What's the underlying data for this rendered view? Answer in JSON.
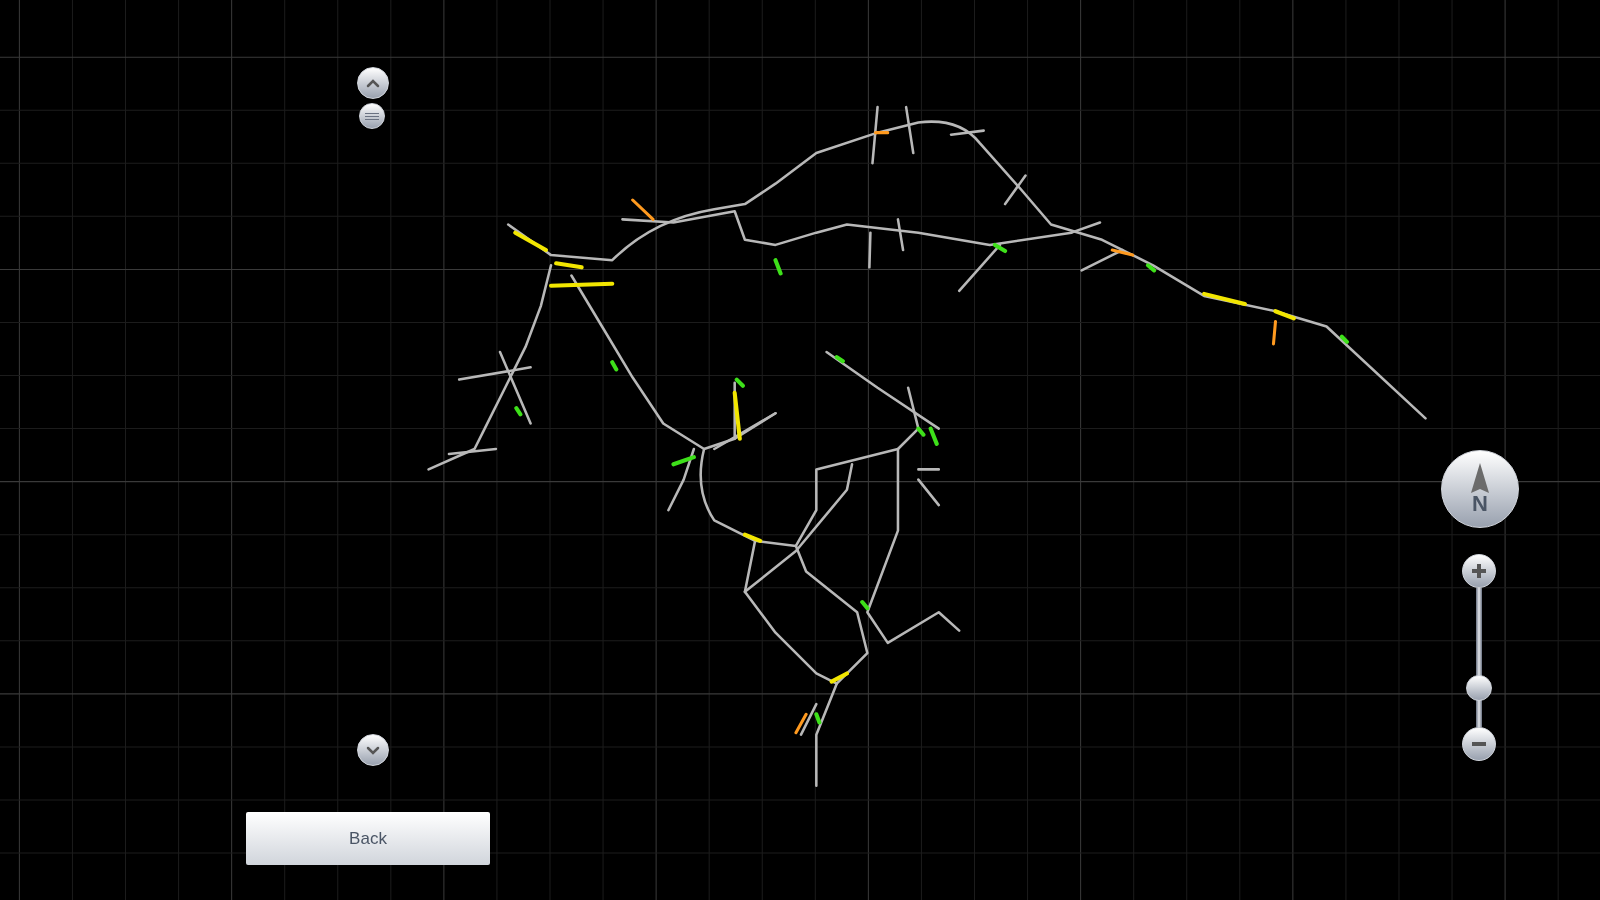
{
  "map_controls": {
    "compass": {
      "label": "N"
    },
    "zoom_slider": {
      "level": 0.23
    }
  },
  "back_button": {
    "label": "Back"
  }
}
